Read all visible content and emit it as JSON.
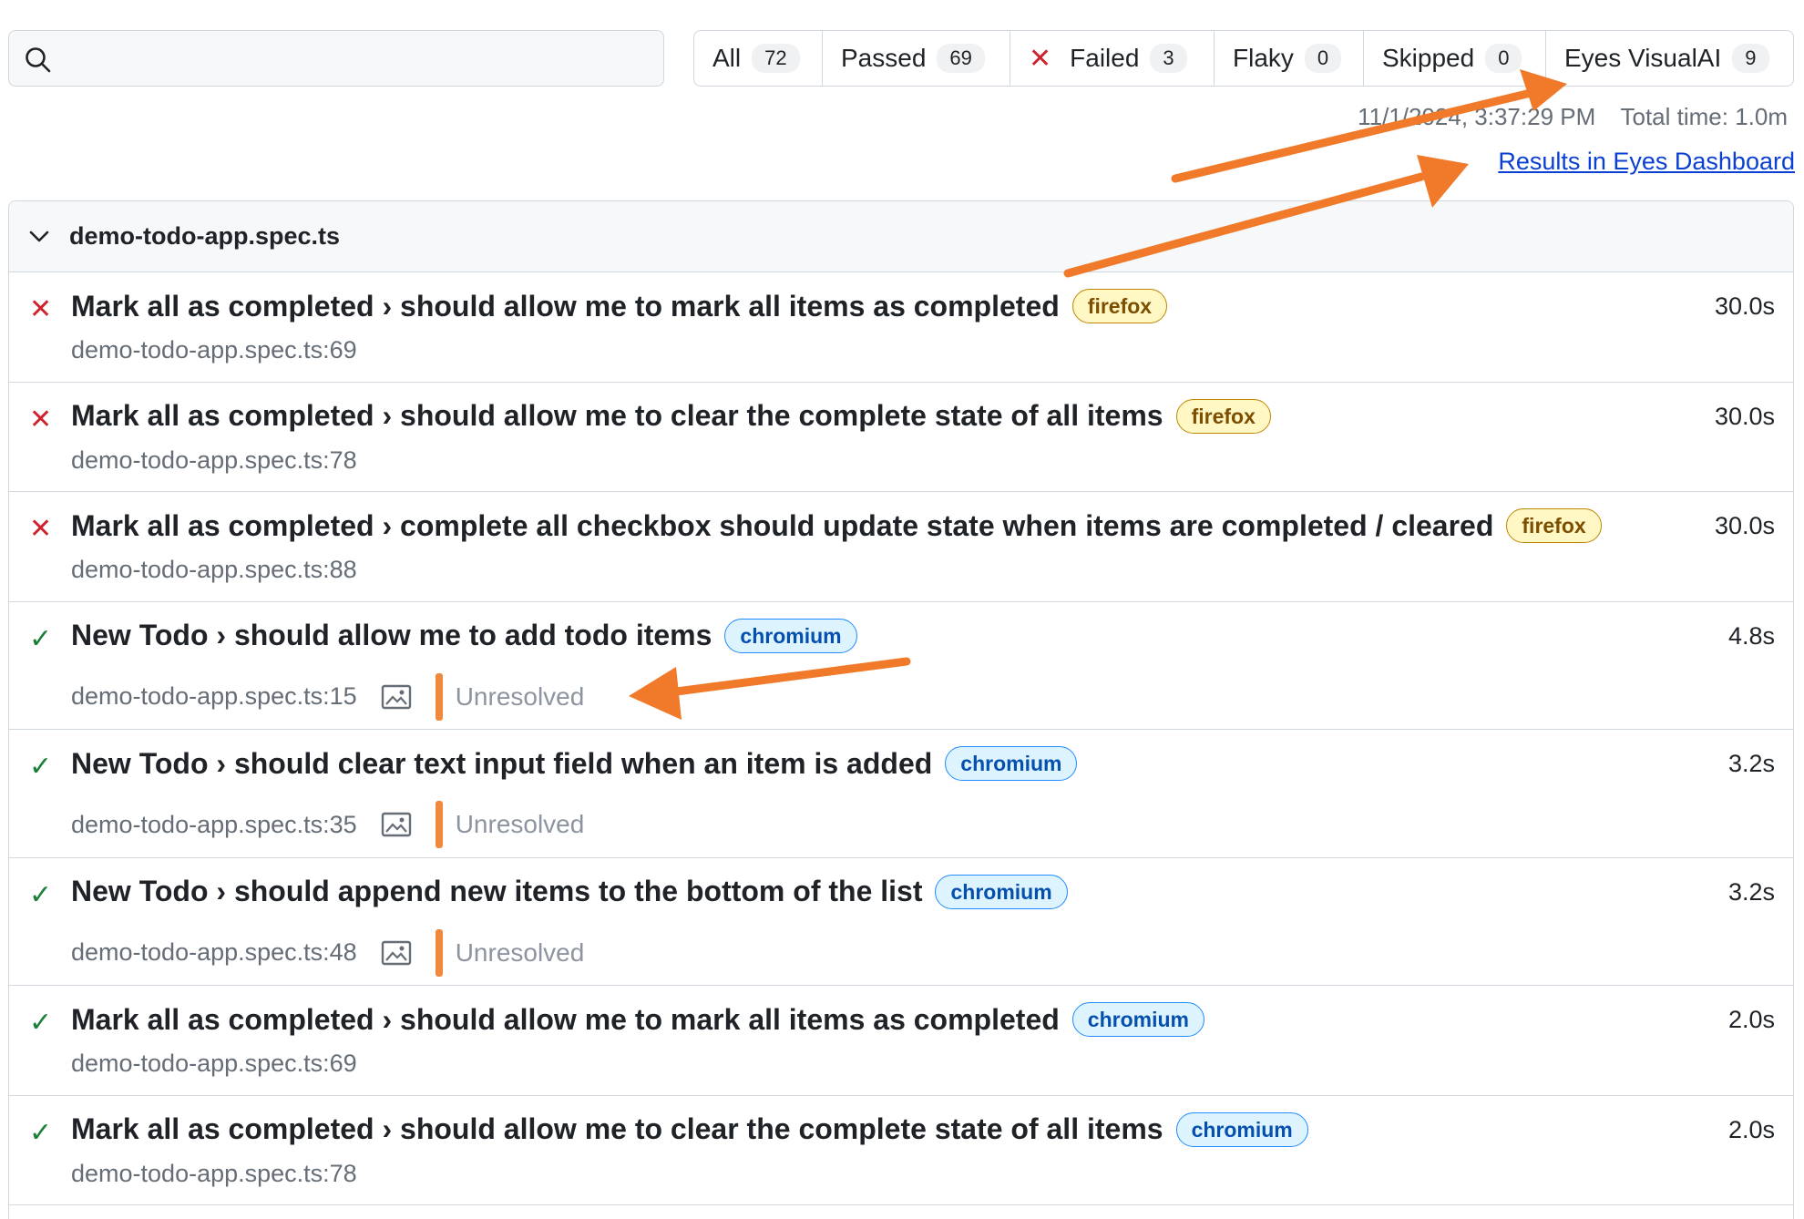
{
  "search": {
    "placeholder": ""
  },
  "tabs": [
    {
      "label": "All",
      "count": "72"
    },
    {
      "label": "Passed",
      "count": "69"
    },
    {
      "label": "Failed",
      "count": "3"
    },
    {
      "label": "Flaky",
      "count": "0"
    },
    {
      "label": "Skipped",
      "count": "0"
    },
    {
      "label": "Eyes VisualAI",
      "count": "9"
    }
  ],
  "meta": {
    "timestamp": "11/1/2024, 3:37:29 PM",
    "total_time": "Total time: 1.0m"
  },
  "dashboard_link": "Results in Eyes Dashboard",
  "group": {
    "file": "demo-todo-app.spec.ts",
    "tests": [
      {
        "status": "failed",
        "title": "Mark all as completed › should allow me to mark all items as completed",
        "browser": "firefox",
        "location": "demo-todo-app.spec.ts:69",
        "duration": "30.0s"
      },
      {
        "status": "failed",
        "title": "Mark all as completed › should allow me to clear the complete state of all items",
        "browser": "firefox",
        "location": "demo-todo-app.spec.ts:78",
        "duration": "30.0s"
      },
      {
        "status": "failed",
        "title": "Mark all as completed › complete all checkbox should update state when items are completed / cleared",
        "browser": "firefox",
        "location": "demo-todo-app.spec.ts:88",
        "duration": "30.0s"
      },
      {
        "status": "passed",
        "title": "New Todo › should allow me to add todo items",
        "browser": "chromium",
        "location": "demo-todo-app.spec.ts:15",
        "duration": "4.8s",
        "visual": "Unresolved"
      },
      {
        "status": "passed",
        "title": "New Todo › should clear text input field when an item is added",
        "browser": "chromium",
        "location": "demo-todo-app.spec.ts:35",
        "duration": "3.2s",
        "visual": "Unresolved"
      },
      {
        "status": "passed",
        "title": "New Todo › should append new items to the bottom of the list",
        "browser": "chromium",
        "location": "demo-todo-app.spec.ts:48",
        "duration": "3.2s",
        "visual": "Unresolved"
      },
      {
        "status": "passed",
        "title": "Mark all as completed › should allow me to mark all items as completed",
        "browser": "chromium",
        "location": "demo-todo-app.spec.ts:69",
        "duration": "2.0s"
      },
      {
        "status": "passed",
        "title": "Mark all as completed › should allow me to clear the complete state of all items",
        "browser": "chromium",
        "location": "demo-todo-app.spec.ts:78",
        "duration": "2.0s"
      }
    ]
  },
  "icons": {
    "fail": "✕",
    "pass": "✓"
  },
  "colors": {
    "annotation_arrow": "#f07a2a",
    "fail": "#cf222e",
    "pass": "#1a7f37",
    "unresolved_bar": "#f0883e"
  }
}
